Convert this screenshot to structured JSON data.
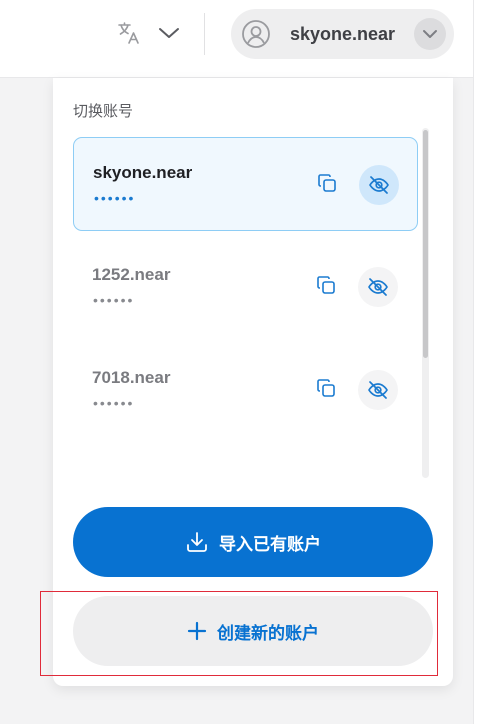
{
  "header": {
    "translate_icon": "translate-icon",
    "lang_chevron_icon": "chevron-down-icon",
    "current_account": "skyone.near",
    "account_avatar_icon": "user-avatar-icon",
    "account_chevron_icon": "chevron-down-icon"
  },
  "switcher": {
    "title": "切换账号",
    "accounts": [
      {
        "name": "skyone.near",
        "masked": "••••••",
        "active": true
      },
      {
        "name": "1252.near",
        "masked": "••••••",
        "active": false
      },
      {
        "name": "7018.near",
        "masked": "••••••",
        "active": false
      }
    ],
    "copy_icon": "copy-icon",
    "hide_icon": "eye-off-icon"
  },
  "actions": {
    "import_label": "导入已有账户",
    "import_icon": "download-icon",
    "create_label": "创建新的账户",
    "create_icon": "plus-icon"
  },
  "colors": {
    "accent": "#0872d1",
    "active_bg": "#f0f8fe",
    "active_border": "#8ecdf5",
    "highlight": "#e02b3a"
  }
}
